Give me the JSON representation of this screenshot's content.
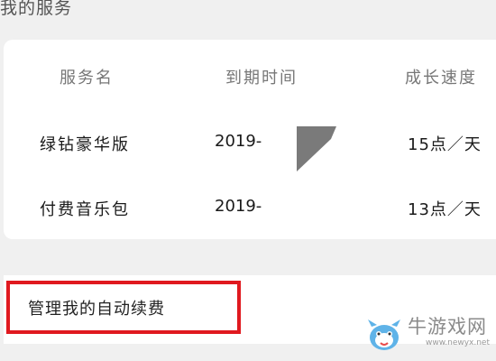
{
  "section_title": "我的服务",
  "table": {
    "headers": [
      "服务名",
      "到期时间",
      "成长速度"
    ],
    "rows": [
      {
        "name": "绿钻豪华版",
        "expiry": "2019-",
        "speed": "15点／天"
      },
      {
        "name": "付费音乐包",
        "expiry": "2019-",
        "speed": "13点／天"
      }
    ]
  },
  "manage": {
    "label": "管理我的自动续费",
    "highlight_color": "#e0191f"
  },
  "watermark": {
    "name": "牛游戏网",
    "url": "www.newyx.net"
  }
}
